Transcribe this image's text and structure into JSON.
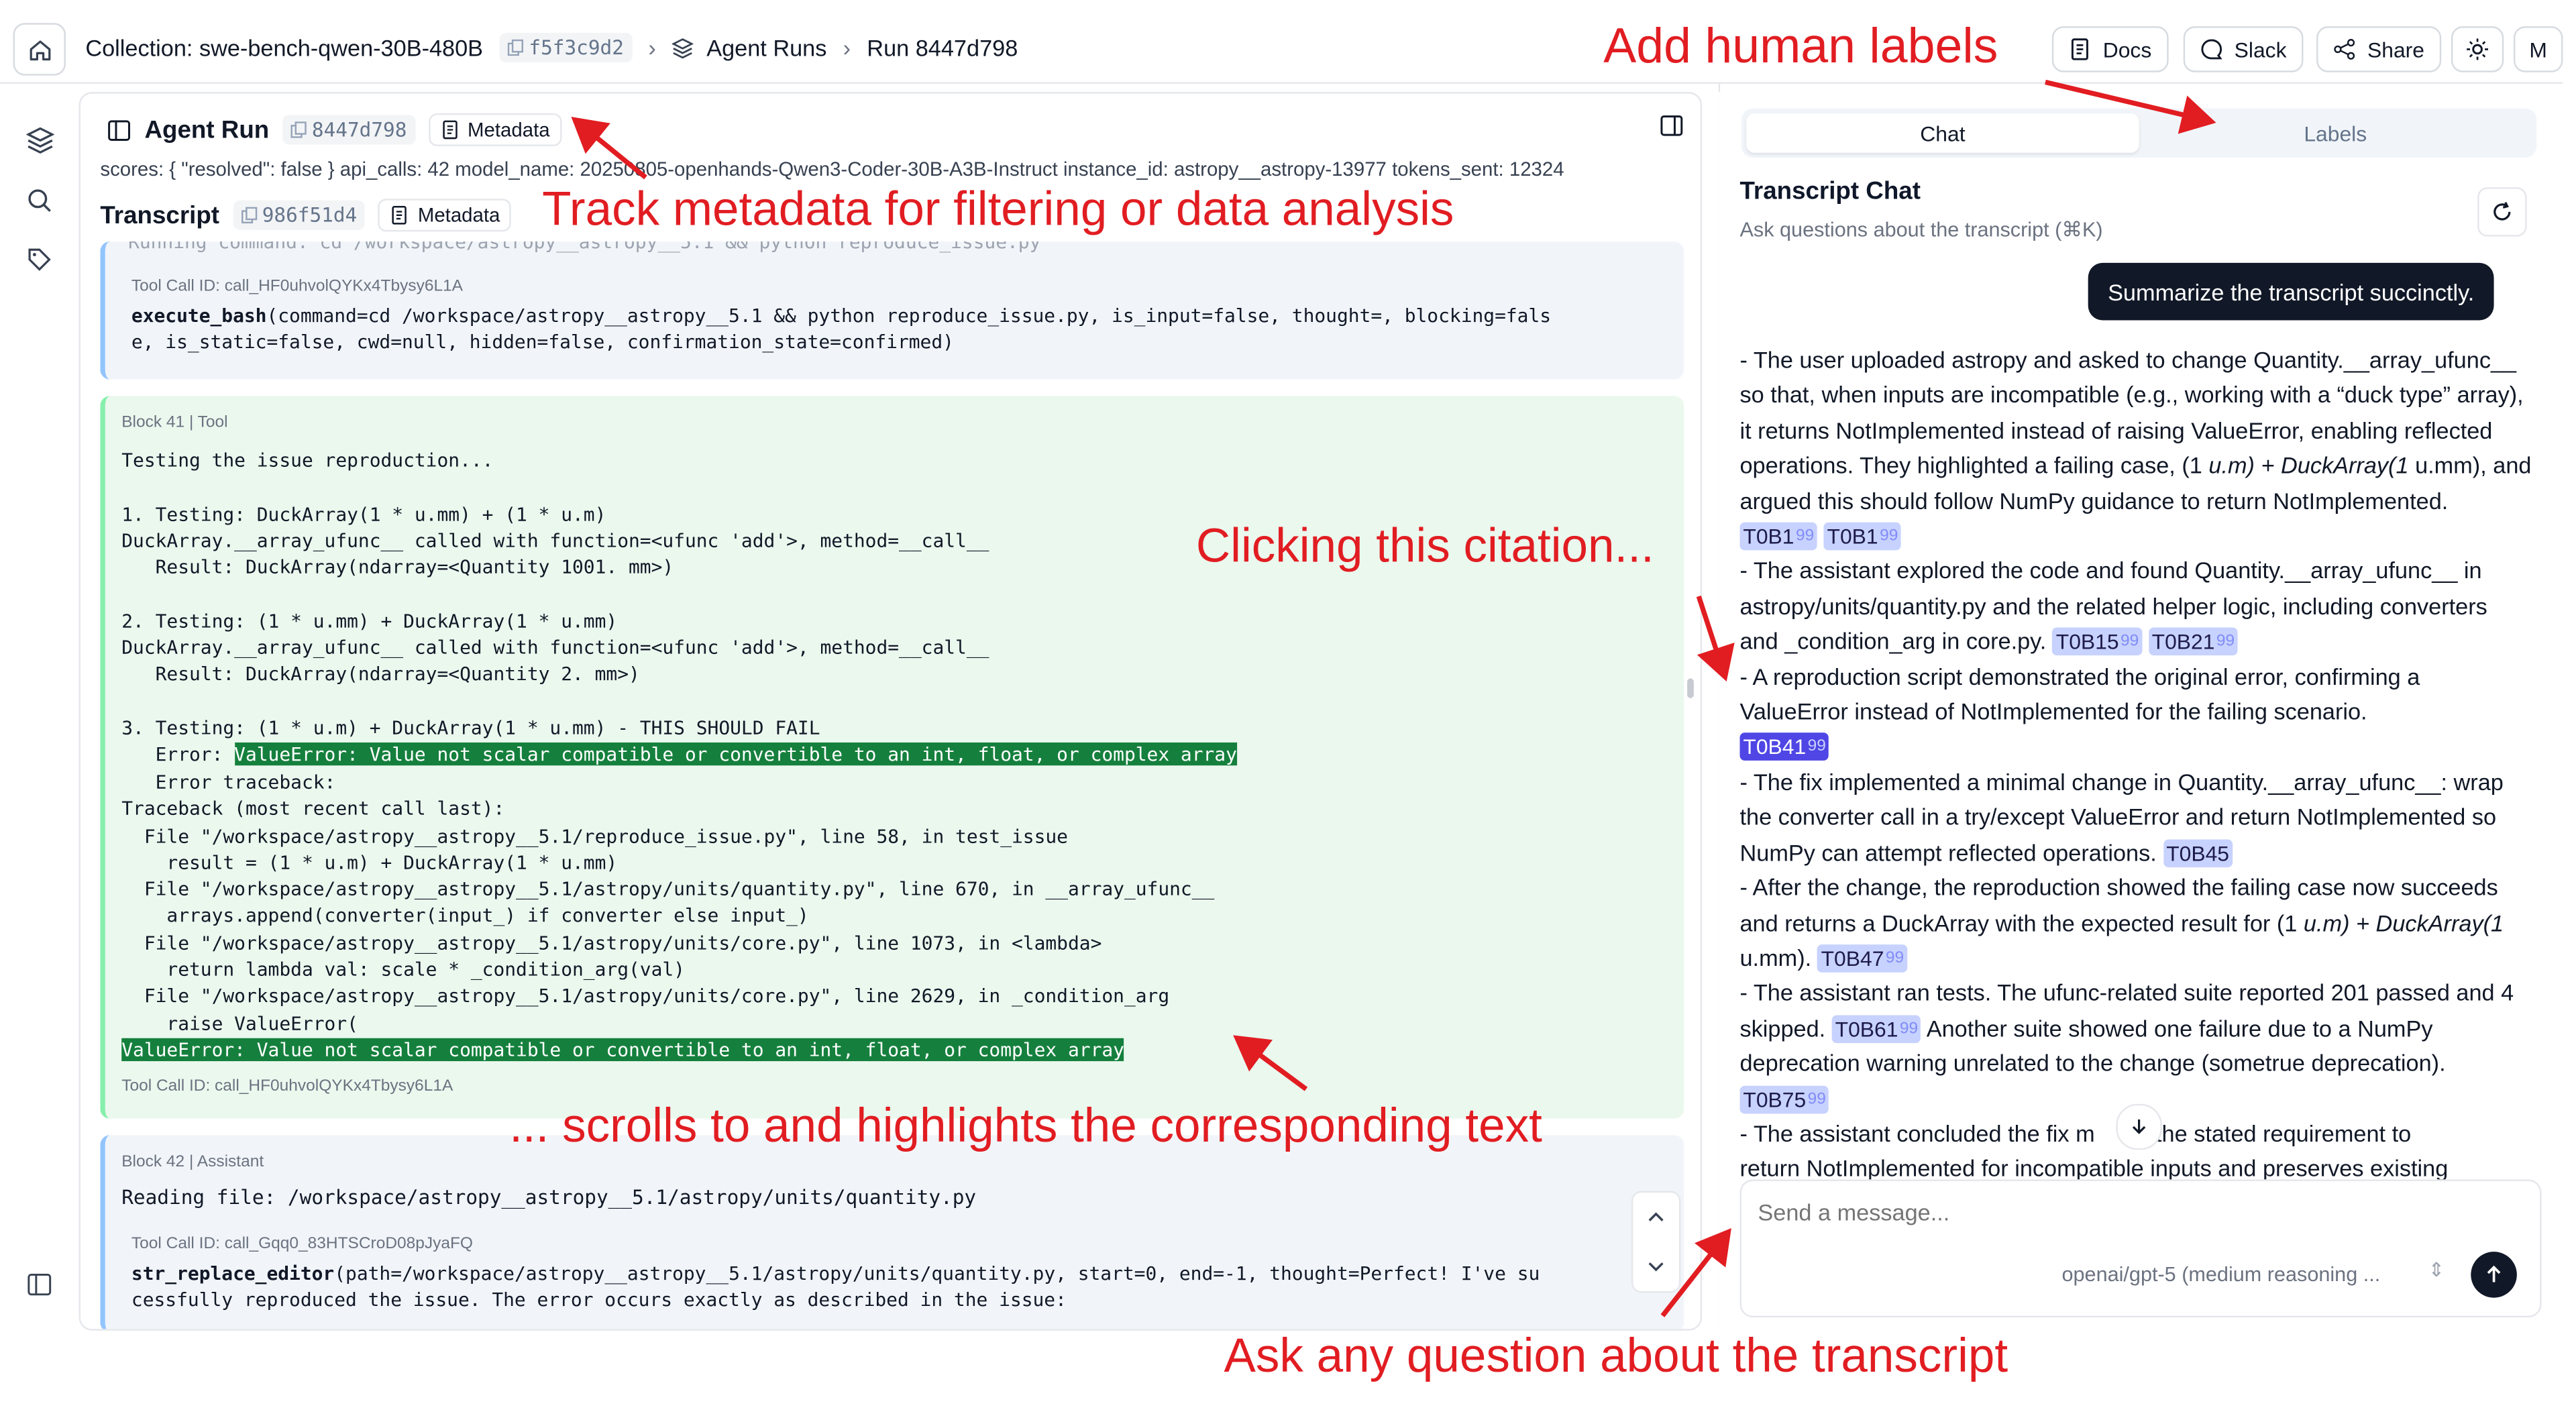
{
  "topbar": {
    "collection": "Collection: swe-bench-qwen-30B-480B",
    "collection_hash": "f5f3c9d2",
    "agent_runs": "Agent Runs",
    "run": "Run 8447d798",
    "buttons": {
      "docs": "Docs",
      "slack": "Slack",
      "share": "Share",
      "avatar": "M"
    }
  },
  "agent_run": {
    "title": "Agent Run",
    "hash": "8447d798",
    "metadata_label": "Metadata",
    "scores_line": "scores: { \"resolved\": false }   api_calls: 42   model_name: 20250805-openhands-Qwen3-Coder-30B-A3B-Instruct   instance_id: astropy__astropy-13977   tokens_sent: 12324"
  },
  "transcript": {
    "title": "Transcript",
    "hash": "986f51d4",
    "metadata_label": "Metadata",
    "top_block": {
      "cut_line": "Running command: cd /workspace/astropy__astropy__5.1 && python reproduce_issue.py",
      "tool_call_id": "Tool Call ID: call_HF0uhvolQYKx4Tbysy6L1A",
      "fn_name": "execute_bash",
      "fn_args": "(command=cd /workspace/astropy__astropy__5.1 && python reproduce_issue.py, is_input=false, thought=, blocking=fals\ne, is_static=false, cwd=null, hidden=false, confirmation_state=confirmed)"
    },
    "block41": {
      "header": "Block 41 | Tool",
      "pre": "Testing the issue reproduction...\n\n1. Testing: DuckArray(1 * u.mm) + (1 * u.m)\nDuckArray.__array_ufunc__ called with function=<ufunc 'add'>, method=__call__\n   Result: DuckArray(ndarray=<Quantity 1001. mm>)\n\n2. Testing: (1 * u.mm) + DuckArray(1 * u.mm)\nDuckArray.__array_ufunc__ called with function=<ufunc 'add'>, method=__call__\n   Result: DuckArray(ndarray=<Quantity 2. mm>)\n\n3. Testing: (1 * u.m) + DuckArray(1 * u.mm) - THIS SHOULD FAIL",
      "error_prefix": "   Error: ",
      "error_highlight": "ValueError: Value not scalar compatible or convertible to an int, float, or complex array",
      "traceback": "   Error traceback:\nTraceback (most recent call last):\n  File \"/workspace/astropy__astropy__5.1/reproduce_issue.py\", line 58, in test_issue\n    result = (1 * u.m) + DuckArray(1 * u.mm)\n  File \"/workspace/astropy__astropy__5.1/astropy/units/quantity.py\", line 670, in __array_ufunc__\n    arrays.append(converter(input_) if converter else input_)\n  File \"/workspace/astropy__astropy__5.1/astropy/units/core.py\", line 1073, in <lambda>\n    return lambda val: scale * _condition_arg(val)\n  File \"/workspace/astropy__astropy__5.1/astropy/units/core.py\", line 2629, in _condition_arg\n    raise ValueError(",
      "final_highlight": "ValueError: Value not scalar compatible or convertible to an int, float, or complex array",
      "tool_call_id": "Tool Call ID: call_HF0uhvolQYKx4Tbysy6L1A"
    },
    "block42": {
      "header": "Block 42 | Assistant",
      "reading": "Reading file: /workspace/astropy__astropy__5.1/astropy/units/quantity.py",
      "tool_call_id": "Tool Call ID: call_Gqq0_83HTSCroD08pJyaFQ",
      "fn_name": "str_replace_editor",
      "fn_args": "(path=/workspace/astropy__astropy__5.1/astropy/units/quantity.py, start=0, end=-1, thought=Perfect! I've su\ncessfully reproduced the issue. The error occurs exactly as described in the issue:"
    }
  },
  "chat": {
    "tabs": [
      "Chat",
      "Labels"
    ],
    "title": "Transcript Chat",
    "subtitle": "Ask questions about the transcript (⌘K)",
    "user_message": "Summarize the transcript succinctly.",
    "p1": "- The user uploaded astropy and asked to change Quantity.__array_ufunc__ so that, when inputs are incompatible (e.g., working with a “duck type” array), it returns NotImplemented instead of raising ValueError, enabling reflected operations. They highlighted a failing case, (1",
    "p1_italic": " u.m) + DuckArray(1",
    "p1_end": " u.mm), and argued this should follow NumPy guidance to return NotImplemented.",
    "p2": "- The assistant explored the code and found Quantity.__array_ufunc__ in astropy/units/quantity.py and the related helper logic, including converters and _condition_arg in core.py.",
    "p3": "- A reproduction script demonstrated the original error, confirming a ValueError instead of NotImplemented for the failing scenario.",
    "p4": "- The fix implemented a minimal change in Quantity.__array_ufunc__: wrap the converter call in a try/except ValueError and return NotImplemented so NumPy can attempt reflected operations.",
    "p5": "- After the change, the reproduction showed the failing case now succeeds and returns a DuckArray with the expected result for (1",
    "p5_italic": " u.m) + DuckArray(1",
    "p5_end": " u.mm).",
    "p6": "- The assistant ran tests. The ufunc-related suite reported 201 passed and 4 skipped.",
    "p6_end": "Another suite showed one failure due to a NumPy deprecation warning unrelated to the change (sometrue deprecation).",
    "p7": "- The assistant concluded the fix m",
    "p7_end": "s the stated requirement to",
    "p8": "return NotImplemented for incompatible inputs and preserves existing",
    "citations": [
      "T0B1",
      "T0B1",
      "T0B15",
      "T0B21",
      "T0B41",
      "T0B45",
      "T0B47",
      "T0B61",
      "T0B75"
    ],
    "input_placeholder": "Send a message...",
    "model": "openai/gpt-5 (medium reasoning ..."
  },
  "annotations": {
    "labels": "Add human labels",
    "metadata": "Track metadata for filtering or data analysis",
    "citation": "Clicking this citation...",
    "scroll": "... scrolls to and highlights the corresponding text",
    "ask": "Ask any question about the transcript"
  },
  "colors": {
    "annotation_red": "#e11d22",
    "highlight_green": "#15803d",
    "citation_bg": "#c7d2fe",
    "citation_active": "#4f46e5"
  }
}
